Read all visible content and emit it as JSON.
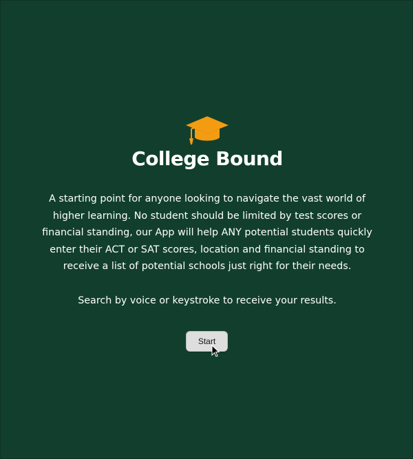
{
  "app": {
    "title": "College Bound",
    "logo_icon": "graduation-cap-icon",
    "description": "A starting point for anyone looking to navigate the vast world of higher learning. No student should be limited by test scores or financial standing, our App will help ANY potential students quickly enter their ACT or SAT scores, location and financial standing to receive a list of potential schools just right for their needs.",
    "search_hint": "Search by voice or keystroke to receive your results.",
    "start_label": "Start"
  },
  "colors": {
    "background": "#123f2d",
    "accent": "#f39c12",
    "text": "#ffffff",
    "button_bg": "#dedede"
  }
}
